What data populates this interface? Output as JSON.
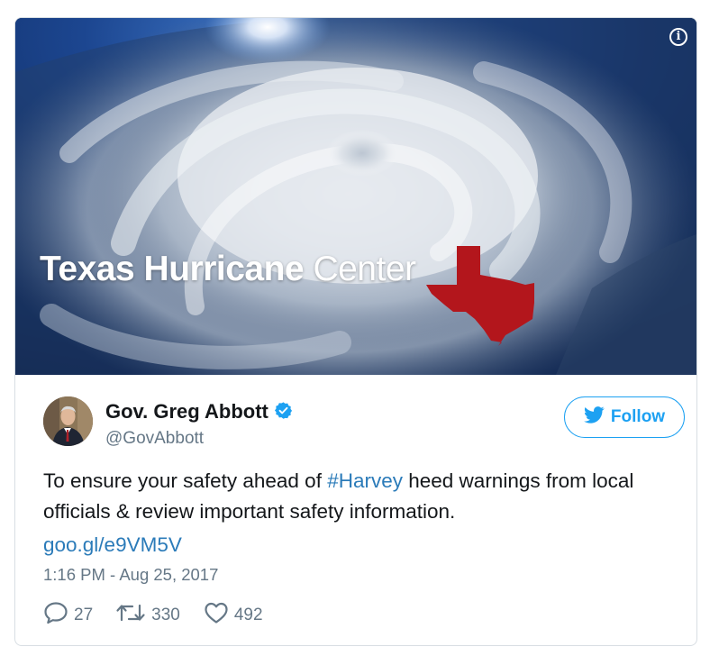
{
  "media": {
    "title_bold": "Texas Hurricane",
    "title_light": "Center",
    "info_icon": "info-icon",
    "colors": {
      "state_fill": "#b3161c",
      "space": "#0b1e3e"
    }
  },
  "author": {
    "name": "Gov. Greg Abbott",
    "handle": "@GovAbbott",
    "verified_icon": "verified-badge-icon"
  },
  "follow": {
    "label": "Follow",
    "icon": "twitter-bird-icon"
  },
  "tweet": {
    "text_before": "To ensure your safety ahead of ",
    "hashtag": "#Harvey",
    "text_after": " heed warnings from local officials & review important safety information.",
    "link": "goo.gl/e9VM5V",
    "timestamp": "1:16 PM - Aug 25, 2017"
  },
  "actions": {
    "replies": "27",
    "retweets": "330",
    "likes": "492"
  },
  "colors": {
    "accent": "#1da1f2",
    "link": "#2b7bb9",
    "muted": "#657786",
    "text": "#14171a",
    "border": "#d8dee3"
  }
}
